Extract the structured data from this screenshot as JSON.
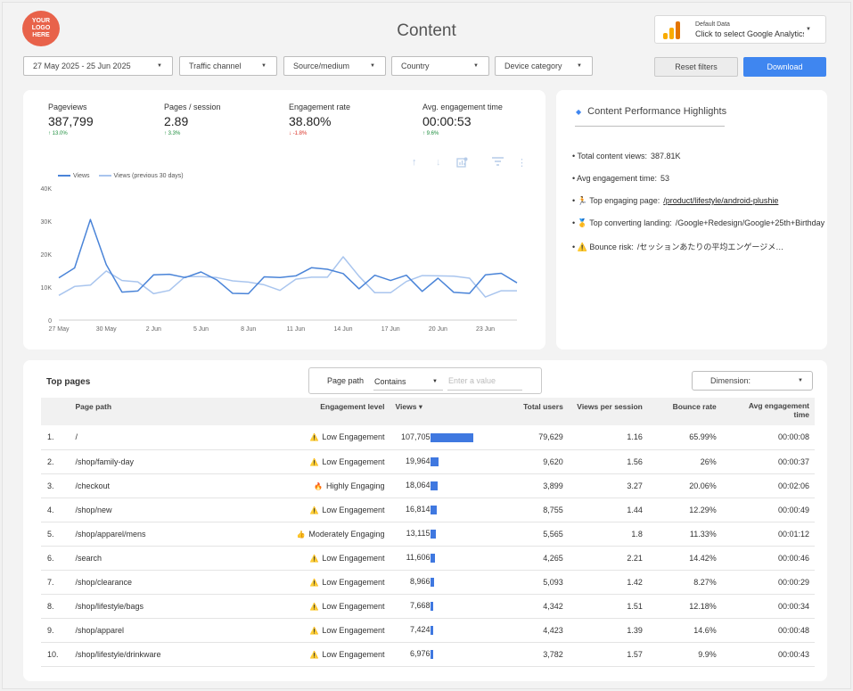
{
  "header": {
    "logo_text": "YOUR\nLOGO\nHERE",
    "title": "Content",
    "data_source": {
      "title": "Default Data",
      "subtitle": "Click to select Google Analytics",
      "icon": "analytics-bars-icon"
    }
  },
  "filters": {
    "date_range": "27 May 2025 - 25 Jun 2025",
    "traffic_channel": "Traffic channel",
    "source_medium": "Source/medium",
    "country": "Country",
    "device_category": "Device category",
    "reset_label": "Reset filters",
    "download_label": "Download"
  },
  "kpis": [
    {
      "label": "Pageviews",
      "value": "387,799",
      "delta": "↑ 13.0%",
      "direction": "up"
    },
    {
      "label": "Pages / session",
      "value": "2.89",
      "delta": "↑ 3.3%",
      "direction": "up"
    },
    {
      "label": "Engagement rate",
      "value": "38.80%",
      "delta": "↓ -1.8%",
      "direction": "down"
    },
    {
      "label": "Avg. engagement time",
      "value": "00:00:53",
      "delta": "↑ 9.6%",
      "direction": "up"
    }
  ],
  "chart_data": {
    "type": "line",
    "x": [
      "27 May",
      "28 May",
      "29 May",
      "30 May",
      "31 May",
      "1 Jun",
      "2 Jun",
      "3 Jun",
      "4 Jun",
      "5 Jun",
      "6 Jun",
      "7 Jun",
      "8 Jun",
      "9 Jun",
      "10 Jun",
      "11 Jun",
      "12 Jun",
      "13 Jun",
      "14 Jun",
      "15 Jun",
      "16 Jun",
      "17 Jun",
      "18 Jun",
      "19 Jun",
      "20 Jun",
      "21 Jun",
      "22 Jun",
      "23 Jun",
      "24 Jun",
      "25 Jun"
    ],
    "x_tick_labels": [
      "27 May",
      "30 May",
      "2 Jun",
      "5 Jun",
      "8 Jun",
      "11 Jun",
      "14 Jun",
      "17 Jun",
      "20 Jun",
      "23 Jun"
    ],
    "y_tick_labels": [
      "0",
      "10K",
      "20K",
      "30K",
      "40K"
    ],
    "ylim": [
      0,
      40000
    ],
    "legend_position": "top-left",
    "series": [
      {
        "name": "Views",
        "color": "#4a84d8",
        "values": [
          12800,
          15800,
          30500,
          16800,
          8500,
          8800,
          13700,
          13900,
          12900,
          14600,
          12200,
          8100,
          8000,
          13100,
          12900,
          13400,
          15900,
          15400,
          14100,
          9500,
          13600,
          12000,
          13600,
          8700,
          12700,
          8400,
          8100,
          13700,
          14200,
          11300
        ]
      },
      {
        "name": "Views (previous 30 days)",
        "color": "#a9c5ee",
        "values": [
          7500,
          10200,
          10600,
          14900,
          12000,
          11600,
          8000,
          9000,
          13200,
          13200,
          12900,
          11900,
          11500,
          10700,
          9000,
          12400,
          13000,
          13000,
          19200,
          13300,
          8300,
          8300,
          11700,
          13500,
          13400,
          13300,
          12700,
          7000,
          8900,
          8900
        ]
      }
    ]
  },
  "highlights": {
    "title": "Content Performance Highlights",
    "items": [
      {
        "label": "• Total content views:",
        "value": "387.81K",
        "icon": ""
      },
      {
        "label": "• Avg engagement time:",
        "value": "53",
        "icon": ""
      },
      {
        "label": "• 🏃 Top engaging page:",
        "value": "/product/lifestyle/android-plushie",
        "icon": "runner-icon"
      },
      {
        "label": "• 🥇 Top converting landing:",
        "value": "/Google+Redesign/Google+25th+Birthday",
        "icon": "medal-icon"
      },
      {
        "label": "• ⚠️ Bounce risk:",
        "value": "/セッションあたりの平均エンゲージメント",
        "icon": "warning-icon"
      }
    ]
  },
  "top_pages": {
    "title": "Top pages",
    "filter_label": "Page path",
    "filter_operator": "Contains",
    "filter_placeholder": "Enter a value",
    "dimension_label": "Dimension:",
    "columns": [
      "Page path",
      "Engagement level",
      "Views ▾",
      "Total users",
      "Views per session",
      "Bounce rate",
      "Avg engagement\ntime"
    ],
    "max_views": 107705,
    "rows": [
      {
        "n": "1.",
        "path": "/",
        "emoji": "⚠️",
        "level": "Low Engagement",
        "views": "107,705",
        "views_num": 107705,
        "users": "79,629",
        "vps": "1.16",
        "bounce": "65.99%",
        "aet": "00:00:08"
      },
      {
        "n": "2.",
        "path": "/shop/family-day",
        "emoji": "⚠️",
        "level": "Low Engagement",
        "views": "19,964",
        "views_num": 19964,
        "users": "9,620",
        "vps": "1.56",
        "bounce": "26%",
        "aet": "00:00:37"
      },
      {
        "n": "3.",
        "path": "/checkout",
        "emoji": "🔥",
        "level": "Highly Engaging",
        "views": "18,064",
        "views_num": 18064,
        "users": "3,899",
        "vps": "3.27",
        "bounce": "20.06%",
        "aet": "00:02:06"
      },
      {
        "n": "4.",
        "path": "/shop/new",
        "emoji": "⚠️",
        "level": "Low Engagement",
        "views": "16,814",
        "views_num": 16814,
        "users": "8,755",
        "vps": "1.44",
        "bounce": "12.29%",
        "aet": "00:00:49"
      },
      {
        "n": "5.",
        "path": "/shop/apparel/mens",
        "emoji": "👍",
        "level": "Moderately Engaging",
        "views": "13,115",
        "views_num": 13115,
        "users": "5,565",
        "vps": "1.8",
        "bounce": "11.33%",
        "aet": "00:01:12"
      },
      {
        "n": "6.",
        "path": "/search",
        "emoji": "⚠️",
        "level": "Low Engagement",
        "views": "11,606",
        "views_num": 11606,
        "users": "4,265",
        "vps": "2.21",
        "bounce": "14.42%",
        "aet": "00:00:46"
      },
      {
        "n": "7.",
        "path": "/shop/clearance",
        "emoji": "⚠️",
        "level": "Low Engagement",
        "views": "8,966",
        "views_num": 8966,
        "users": "5,093",
        "vps": "1.42",
        "bounce": "8.27%",
        "aet": "00:00:29"
      },
      {
        "n": "8.",
        "path": "/shop/lifestyle/bags",
        "emoji": "⚠️",
        "level": "Low Engagement",
        "views": "7,668",
        "views_num": 7668,
        "users": "4,342",
        "vps": "1.51",
        "bounce": "12.18%",
        "aet": "00:00:34"
      },
      {
        "n": "9.",
        "path": "/shop/apparel",
        "emoji": "⚠️",
        "level": "Low Engagement",
        "views": "7,424",
        "views_num": 7424,
        "users": "4,423",
        "vps": "1.39",
        "bounce": "14.6%",
        "aet": "00:00:48"
      },
      {
        "n": "10.",
        "path": "/shop/lifestyle/drinkware",
        "emoji": "⚠️",
        "level": "Low Engagement",
        "views": "6,976",
        "views_num": 6976,
        "users": "3,782",
        "vps": "1.57",
        "bounce": "9.9%",
        "aet": "00:00:43"
      }
    ]
  }
}
